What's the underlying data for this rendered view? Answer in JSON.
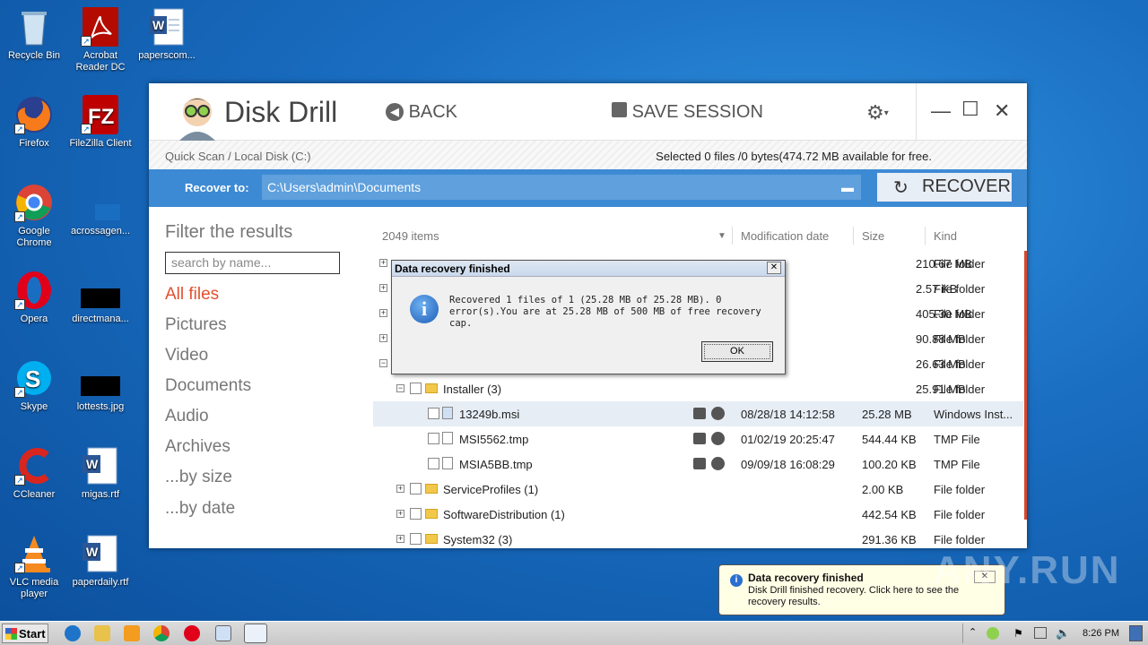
{
  "desktop": {
    "icons": [
      {
        "label": "Recycle Bin"
      },
      {
        "label": "Acrobat Reader DC"
      },
      {
        "label": "paperscom..."
      },
      {
        "label": "Firefox"
      },
      {
        "label": "FileZilla Client"
      },
      {
        "label": "Google Chrome"
      },
      {
        "label": "acrossagen..."
      },
      {
        "label": "Opera"
      },
      {
        "label": "directmana..."
      },
      {
        "label": "Skype"
      },
      {
        "label": "lottests.jpg"
      },
      {
        "label": "CCleaner"
      },
      {
        "label": "migas.rtf"
      },
      {
        "label": "VLC media player"
      },
      {
        "label": "paperdaily.rtf"
      }
    ],
    "watermark": "ANY.RUN"
  },
  "app": {
    "name": "Disk Drill",
    "back_label": "BACK",
    "save_label": "SAVE SESSION",
    "breadcrumb": "Quick Scan / Local Disk (C:)",
    "selection_info": "Selected 0 files /0 bytes(474.72 MB available for free.",
    "recover_to_label": "Recover to:",
    "recover_path": "C:\\Users\\admin\\Documents",
    "recover_button": "RECOVER",
    "accent_color": "#3d8ad4",
    "active_filter_color": "#e4502e"
  },
  "sidebar": {
    "title": "Filter the results",
    "search_placeholder": "search by name...",
    "filters": [
      {
        "label": "All files"
      },
      {
        "label": "Pictures"
      },
      {
        "label": "Video"
      },
      {
        "label": "Documents"
      },
      {
        "label": "Audio"
      },
      {
        "label": "Archives"
      },
      {
        "label": "...by size"
      },
      {
        "label": "...by date"
      }
    ]
  },
  "table": {
    "count": "2049 items",
    "headers": {
      "date": "Modification date",
      "size": "Size",
      "kind": "Kind"
    },
    "hidden_rows": [
      {
        "size": "210.67 MB",
        "kind": "File folder"
      },
      {
        "size": "2.57 KB",
        "kind": "File folder"
      },
      {
        "size": "405.30 MB",
        "kind": "File folder"
      },
      {
        "size": "90.88 MB",
        "kind": "File folder"
      },
      {
        "size": "26.63 MB",
        "kind": "File folder"
      }
    ],
    "rows": [
      {
        "name": "Installer (3)",
        "date": "",
        "size": "25.91 MB",
        "kind": "File folder"
      },
      {
        "name": "13249b.msi",
        "date": "08/28/18 14:12:58",
        "size": "25.28 MB",
        "kind": "Windows Inst..."
      },
      {
        "name": "MSI5562.tmp",
        "date": "01/02/19 20:25:47",
        "size": "544.44 KB",
        "kind": "TMP File"
      },
      {
        "name": "MSIA5BB.tmp",
        "date": "09/09/18 16:08:29",
        "size": "100.20 KB",
        "kind": "TMP File"
      },
      {
        "name": "ServiceProfiles (1)",
        "date": "",
        "size": "2.00 KB",
        "kind": "File folder"
      },
      {
        "name": "SoftwareDistribution (1)",
        "date": "",
        "size": "442.54 KB",
        "kind": "File folder"
      },
      {
        "name": "System32 (3)",
        "date": "",
        "size": "291.36 KB",
        "kind": "File folder"
      }
    ]
  },
  "dialog": {
    "title": "Data recovery finished",
    "message": "Recovered 1 files of 1 (25.28 MB of 25.28 MB). 0 error(s).You are at 25.28 MB of 500 MB of free recovery cap.",
    "ok_label": "OK"
  },
  "balloon": {
    "title": "Data recovery finished",
    "message": "Disk Drill finished recovery. Click here to see the recovery results."
  },
  "taskbar": {
    "start_label": "Start",
    "time": "8:26 PM"
  }
}
